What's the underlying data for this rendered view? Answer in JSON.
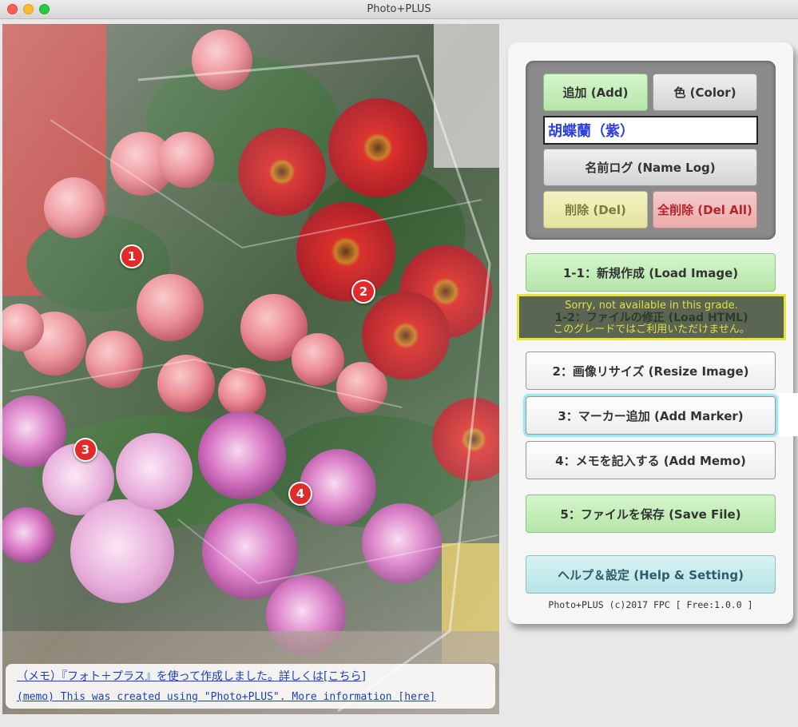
{
  "window": {
    "title": "Photo+PLUS"
  },
  "photo": {
    "markers": [
      "1",
      "2",
      "3",
      "4"
    ],
    "memo": {
      "line_ja": "（メモ）『フォト＋プラス』を使って作成しました。詳しくは[こちら]",
      "line_en": "(memo) This was created using \"Photo+PLUS\". More information [here]"
    }
  },
  "name_box": {
    "add_label": "追加 (Add)",
    "color_label": "色 (Color)",
    "name_value": "胡蝶蘭（紫）",
    "name_log_label": "名前ログ (Name Log)",
    "del_label": "削除 (Del)",
    "del_all_label": "全削除 (Del All)"
  },
  "actions": {
    "load_image": "1-1：新規作成 (Load Image)",
    "load_html": "1-2：ファイルの修正 (Load HTML)",
    "unavailable_en": "Sorry, not available in this grade.",
    "unavailable_ja": "このグレードではご利用いただけません。",
    "resize_image": "2：画像リサイズ (Resize Image)",
    "add_marker": "3：マーカー追加 (Add Marker)",
    "add_memo": "4：メモを記入する (Add Memo)",
    "save_file": "5：ファイルを保存 (Save File)",
    "help": "ヘルプ＆設定 (Help & Setting)"
  },
  "footer": {
    "text": "Photo+PLUS (c)2017 FPC [ Free:1.0.0 ]"
  },
  "colors": {
    "marker": "#e32a2a",
    "name_text": "#2b3ee0",
    "memo_link": "#1b3fc4",
    "warning_border": "#e8e43a"
  }
}
